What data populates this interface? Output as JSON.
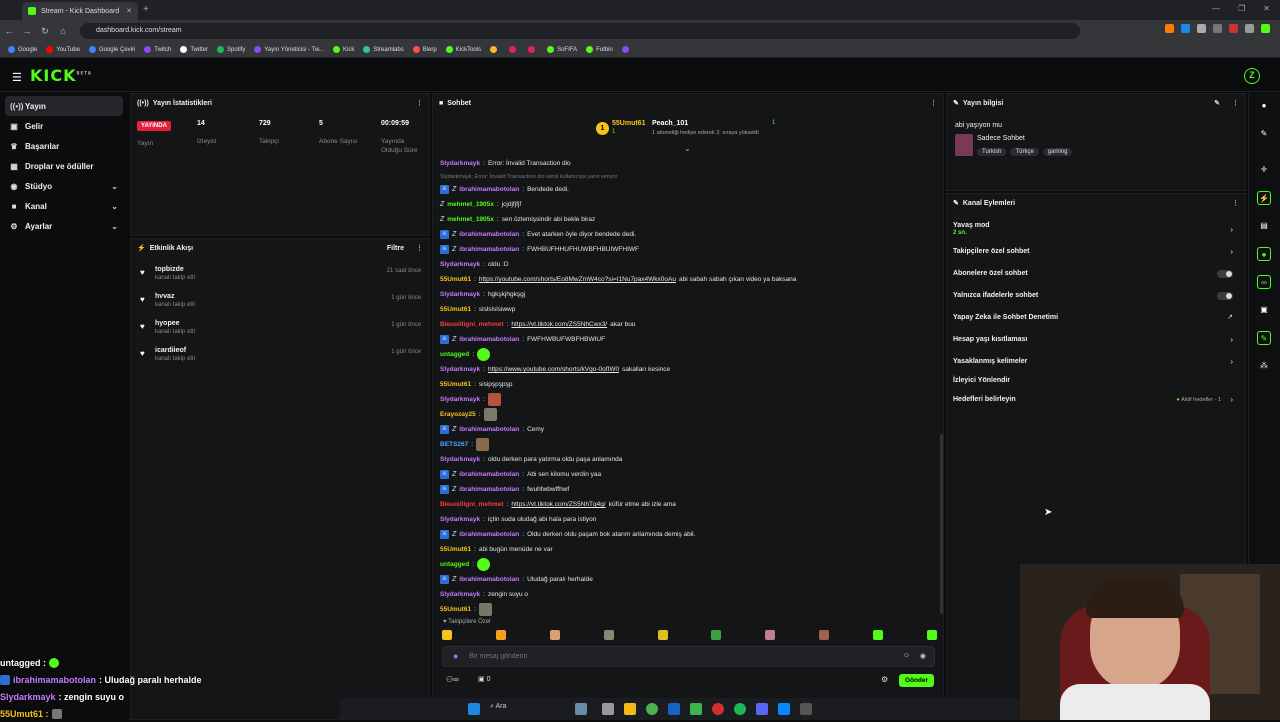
{
  "browser": {
    "tab_title": "Stream - Kick Dashboard",
    "new_tab": "+",
    "url": "dashboard.kick.com/stream",
    "bookmarks": [
      {
        "label": "Google",
        "color": "#4285f4"
      },
      {
        "label": "YouTube",
        "color": "#ff0000"
      },
      {
        "label": "Google Çeviri",
        "color": "#4285f4"
      },
      {
        "label": "Twitch",
        "color": "#9146ff"
      },
      {
        "label": "Twitter",
        "color": "#ffffff"
      },
      {
        "label": "Spotify",
        "color": "#1db954"
      },
      {
        "label": "Yayın Yöneticisi - Tw...",
        "color": "#9146ff"
      },
      {
        "label": "Kick",
        "color": "#53fc18"
      },
      {
        "label": "Streamlabs",
        "color": "#31c3a2"
      },
      {
        "label": "Blerp",
        "color": "#ff4d4d"
      },
      {
        "label": "KickTools",
        "color": "#53fc18"
      },
      {
        "label": "",
        "color": "#f3ba2f"
      },
      {
        "label": "",
        "color": "#e0245e"
      },
      {
        "label": "",
        "color": "#e0245e"
      },
      {
        "label": "SoFIFA",
        "color": "#53fc18"
      },
      {
        "label": "Futbin",
        "color": "#53fc18"
      },
      {
        "label": "",
        "color": "#9146ff"
      }
    ]
  },
  "header": {
    "logo": "KICK",
    "logo_sup": "BETA",
    "avatar": "Z"
  },
  "sidebar": {
    "items": [
      {
        "label": "Yayın",
        "icon": "broadcast-icon",
        "glyph": "((•))",
        "active": true
      },
      {
        "label": "Gelir",
        "icon": "money-icon",
        "glyph": "▣"
      },
      {
        "label": "Başarılar",
        "icon": "trophy-icon",
        "glyph": "♛"
      },
      {
        "label": "Droplar ve ödüller",
        "icon": "gift-icon",
        "glyph": "▦"
      },
      {
        "label": "Stüdyo",
        "icon": "studio-icon",
        "glyph": "◉",
        "chevron": true
      },
      {
        "label": "Kanal",
        "icon": "channel-icon",
        "glyph": "■",
        "chevron": true
      },
      {
        "label": "Ayarlar",
        "icon": "settings-icon",
        "glyph": "⚙",
        "chevron": true
      }
    ]
  },
  "stats": {
    "title": "Yayın İstatistikleri",
    "live_badge": "YAYINDA",
    "stream_label": "Yayın",
    "viewers_value": "14",
    "viewers_label": "İzleyici",
    "followers_value": "729",
    "followers_label": "Takipçi",
    "subs_value": "5",
    "subs_label": "Abone Sayısı",
    "uptime_value": "00:09:59",
    "uptime_label": "Yayında Olduğu Süre"
  },
  "activity": {
    "title": "Etkinlik Akışı",
    "filter": "Filtre",
    "items": [
      {
        "user": "topbizde",
        "action": "kanalı takip etti",
        "time": "21 saat önce"
      },
      {
        "user": "hvvaz",
        "action": "kanalı takip etti",
        "time": "1 gün önce"
      },
      {
        "user": "hyopee",
        "action": "kanalı takip etti",
        "time": "1 gün önce"
      },
      {
        "user": "icardiieof",
        "action": "kanalı takip etti",
        "time": "1 gün önce"
      }
    ]
  },
  "chat": {
    "title": "Sohbet",
    "pinned": {
      "user1": "55Umut61",
      "count1": "1",
      "user2": "Peach_101",
      "count2": "1",
      "note": "1 aboneliği hediye ederek 3. sıraya yükseldi"
    },
    "system_note": "Slydarkmayk: Error: İnvalid Transaction dio isimli kullanıcıya yanıt veriyor",
    "followers_only": "Takipçilere Özel",
    "input_placeholder": "Bir mesaj gönderin",
    "points": "0",
    "send": "Gönder",
    "lines": [
      {
        "user": "Slydarkmayk",
        "color": "#c57cff",
        "badge": false,
        "text": "Error: İnvalid Transaction dio"
      },
      {
        "user": "ibrahimamabotolan",
        "color": "#c57cff",
        "badge": true,
        "text": "Bendede dedi."
      },
      {
        "user": "mehmet_1905x",
        "color": "#53fc18",
        "badge": false,
        "k": true,
        "text": "jcjdjfjfjf"
      },
      {
        "user": "mehmet_1905x",
        "color": "#53fc18",
        "badge": false,
        "k": true,
        "text": "sen özlemişsindir abi bekle biraz"
      },
      {
        "user": "ibrahimamabotolan",
        "color": "#c57cff",
        "badge": true,
        "text": "Evet atarken öyle diyor bendede dedi."
      },
      {
        "user": "ibrahimamabotolan",
        "color": "#c57cff",
        "badge": true,
        "text": "FWHBUFHHUFHUWBFHBUIWFHIWF"
      },
      {
        "user": "Slydarkmayk",
        "color": "#c57cff",
        "badge": false,
        "text": "oldu :D"
      },
      {
        "user": "55Umut61",
        "color": "#f5c518",
        "badge": false,
        "link": "https://youtube.com/shorts/Eo8MwZmW4co?si=I1Nu7pax4Wkx0oAu",
        "text": " abi sabah sabah çıkan video ya baksana"
      },
      {
        "user": "Slydarkmayk",
        "color": "#c57cff",
        "badge": false,
        "text": "hgkşkjhgkşgj"
      },
      {
        "user": "55Umut61",
        "color": "#f5c518",
        "badge": false,
        "text": "slslslslsiwwp"
      },
      {
        "user": "Bleuoilligni_mehmet",
        "color": "#ff3b3b",
        "badge": false,
        "link": "https://vt.tiktok.com/ZS5NhCwx3/",
        "text": " akar buu"
      },
      {
        "user": "ibrahimamabotolan",
        "color": "#c57cff",
        "badge": true,
        "text": "FWFHWBUFWBFHBWIUF"
      },
      {
        "user": "untagged",
        "color": "#53fc18",
        "badge": false,
        "emote": "#53fc18",
        "text": ""
      },
      {
        "user": "Slydarkmayk",
        "color": "#c57cff",
        "badge": false,
        "link": "https://www.youtube.com/shorts/kVgo-0ofIW0",
        "text": " sakalları kesince"
      },
      {
        "user": "55Umut61",
        "color": "#f5c518",
        "badge": false,
        "text": "sisipşpşpşp"
      },
      {
        "user": "Slydarkmayk",
        "color": "#c57cff",
        "badge": false,
        "emote": "#b5543a",
        "text": ""
      },
      {
        "user": "Erayozay25",
        "color": "#f5c518",
        "badge": false,
        "emote": "#7a7a6a",
        "text": ""
      },
      {
        "user": "ibrahimamabotolan",
        "color": "#c57cff",
        "badge": true,
        "text": "Cemy"
      },
      {
        "user": "BETS267",
        "color": "#4fa3ff",
        "badge": false,
        "emote": "#8a6a4a",
        "text": ""
      },
      {
        "user": "Slydarkmayk",
        "color": "#c57cff",
        "badge": false,
        "text": "oldu derken para yatırma oldu paşa anlamında"
      },
      {
        "user": "ibrahimamabotolan",
        "color": "#c57cff",
        "badge": true,
        "text": "Abi sen kilomu verdin yaa"
      },
      {
        "user": "ibrahimamabotolan",
        "color": "#c57cff",
        "badge": true,
        "text": "fwuhfwbwffhwf"
      },
      {
        "user": "Bleuoilligni_mehmet",
        "color": "#ff3b3b",
        "badge": false,
        "link": "https://vt.tiktok.com/ZS5NhTq4g/",
        "text": " küfür etme abi izle ama"
      },
      {
        "user": "Slydarkmayk",
        "color": "#c57cff",
        "badge": false,
        "text": "içtin suda uludağ abi hala para istiyon"
      },
      {
        "user": "ibrahimamabotolan",
        "color": "#c57cff",
        "badge": true,
        "text": "Oldu derken oldu paşam bok atarım anlamında demiş abil."
      },
      {
        "user": "55Umut61",
        "color": "#f5c518",
        "badge": false,
        "text": "abi bugün menüde ne var"
      },
      {
        "user": "untagged",
        "color": "#53fc18",
        "badge": false,
        "emote": "#53fc18",
        "text": ""
      },
      {
        "user": "ibrahimamabotolan",
        "color": "#c57cff",
        "badge": true,
        "text": "Uludağ paralı herhalde"
      },
      {
        "user": "Slydarkmayk",
        "color": "#c57cff",
        "badge": false,
        "text": "zengin suyu o"
      },
      {
        "user": "55Umut61",
        "color": "#f5c518",
        "badge": false,
        "emote": "#777766",
        "text": ""
      }
    ],
    "emotes": [
      "#f5c518",
      "#f5a020",
      "#d9a070",
      "#888877",
      "#e0c020",
      "#3aa040",
      "#c08090",
      "#a06050",
      "#53fc18",
      "#53fc18"
    ]
  },
  "info": {
    "title": "Yayın bilgisi",
    "stream_title": "abi yaşıyon mu",
    "category": "Sadece Sohbet",
    "tags": [
      "Turkish",
      "Türkçe",
      "gaming"
    ]
  },
  "actions": {
    "title": "Kanal Eylemleri",
    "slow_mode": "Yavaş mod",
    "slow_mode_sub": "2 sn.",
    "followers_chat": "Takipçilere özel sohbet",
    "subs_chat": "Abonelere özel sohbet",
    "emote_chat": "Yalnızca ifadelerle sohbet",
    "ai_mod": "Yapay Zeka ile Sohbet Denetimi",
    "age_limit": "Hesap yaşı kısıtlaması",
    "banned_words": "Yasaklanmış kelimeler",
    "viewer_redirect": "İzleyici Yönlendir",
    "goals": "Hedefleri belirleyin",
    "goals_status": "Aktif hedefler - 1"
  },
  "overlay": {
    "line1_user": "untagged :",
    "line2_user": "ibrahimamabotolan",
    "line2_text": " : Uludağ paralı herhalde",
    "line3_user": "Slydarkmayk",
    "line3_text": " : zengin suyu o",
    "line4_user": "55Umut61 :"
  },
  "taskbar": {
    "search": "Ara"
  }
}
